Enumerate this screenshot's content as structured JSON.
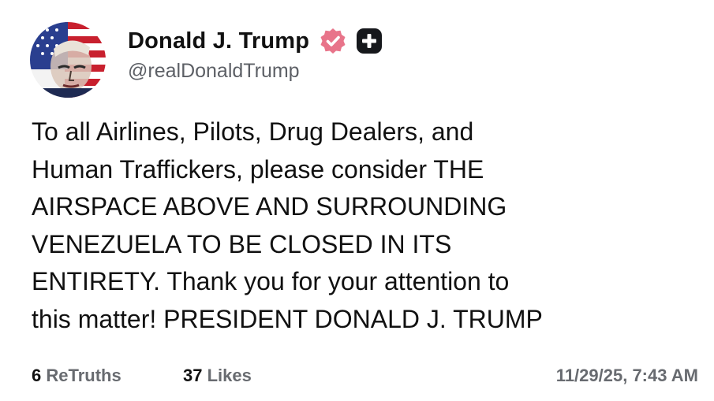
{
  "author": {
    "display_name": "Donald J. Trump",
    "handle": "@realDonaldTrump",
    "avatar_icon": "avatar-flag-portrait",
    "verified_icon": "verified-badge-icon",
    "verified_color": "#e8748a",
    "plus_icon": "plus-badge-icon"
  },
  "post": {
    "lines": [
      "To all Airlines, Pilots, Drug Dealers, and",
      "Human Traffickers, please consider THE",
      "AIRSPACE ABOVE AND SURROUNDING",
      "VENEZUELA TO BE CLOSED IN ITS",
      "ENTIRETY. Thank you for your attention to",
      "this matter! PRESIDENT DONALD J. TRUMP"
    ]
  },
  "stats": {
    "retruths_count": "6",
    "retruths_label": "ReTruths",
    "likes_count": "37",
    "likes_label": "Likes"
  },
  "timestamp": "11/29/25, 7:43 AM"
}
